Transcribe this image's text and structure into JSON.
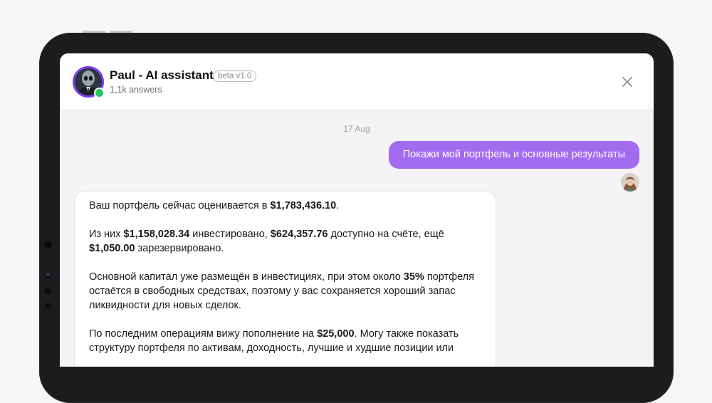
{
  "header": {
    "title": "Paul - AI assistant",
    "badge": "beta v1.0",
    "subtitle": "1,1k answers"
  },
  "chat": {
    "date": "17 Aug",
    "user_message": "Покажи мой портфель и основные результаты",
    "bot_message": {
      "p1": {
        "t1": "Ваш портфель сейчас оценивается в ",
        "b1": "$1,783,436.10",
        "t2": "."
      },
      "p2": {
        "t1": "Из них ",
        "b1": "$1,158,028.34",
        "t2": " инвестировано, ",
        "b2": "$624,357.76",
        "t3": " доступно на счёте, ещё ",
        "b3": "$1,050.00",
        "t4": " зарезервировано."
      },
      "p3": {
        "t1": "Основной капитал уже размещён в инвестициях, при этом около ",
        "b1": "35%",
        "t2": " портфеля остаётся в свободных средствах, поэтому у вас сохраняется хороший запас ликвидности для новых сделок."
      },
      "p4": {
        "t1": "По последним операциям вижу пополнение на ",
        "b1": "$25,000",
        "t2": ". Могу также показать структуру портфеля по активам, доходность, лучшие и худшие позиции или"
      }
    }
  },
  "icons": {
    "close": "close-icon",
    "assistant_avatar": "alien-avatar-icon",
    "user_avatar": "user-avatar-icon"
  },
  "colors": {
    "accent": "#a26bf0",
    "avatar_ring": "#7c3aed",
    "online": "#22c55e"
  }
}
